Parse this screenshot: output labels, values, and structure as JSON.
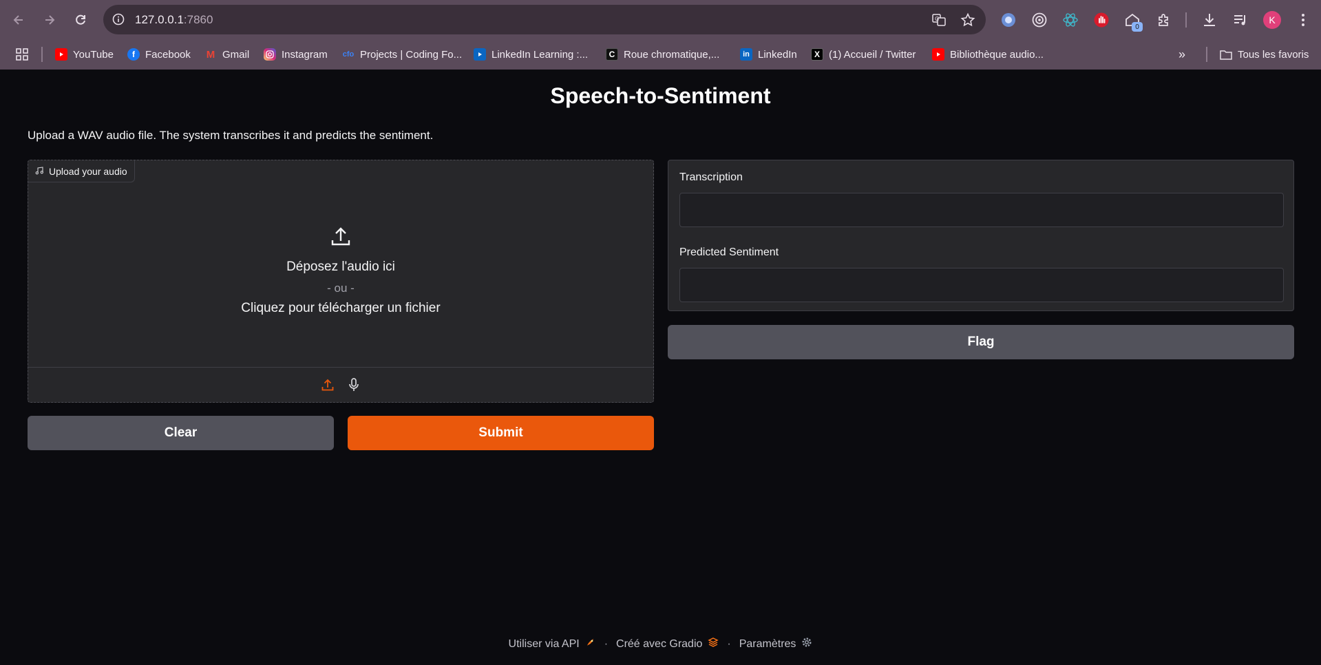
{
  "browser": {
    "url_host": "127.0.0.1",
    "url_port": ":7860",
    "avatar_letter": "K",
    "extension_badge": "0"
  },
  "bookmarks": [
    {
      "label": "YouTube",
      "icon": "youtube-icon",
      "color": "#ff0000"
    },
    {
      "label": "Facebook",
      "icon": "facebook-icon",
      "color": "#1877f2"
    },
    {
      "label": "Gmail",
      "icon": "gmail-icon",
      "color": "#ea4335"
    },
    {
      "label": "Instagram",
      "icon": "instagram-icon",
      "color": "#d62976"
    },
    {
      "label": "Projects | Coding Fo...",
      "icon": "codingfont-icon",
      "color": "#3b82f6"
    },
    {
      "label": "LinkedIn Learning :...",
      "icon": "linkedin-learning-icon",
      "color": "#0a66c2"
    },
    {
      "label": "Roue chromatique,...",
      "icon": "adobe-color-icon",
      "color": "#111111"
    },
    {
      "label": "LinkedIn",
      "icon": "linkedin-icon",
      "color": "#0a66c2"
    },
    {
      "label": "(1) Accueil / Twitter",
      "icon": "x-icon",
      "color": "#000000"
    },
    {
      "label": "Bibliothèque audio...",
      "icon": "youtube-icon",
      "color": "#ff0000"
    }
  ],
  "bookmarks_folder": "Tous les favoris",
  "app": {
    "title": "Speech-to-Sentiment",
    "description": "Upload a WAV audio file. The system transcribes it and predicts the sentiment.",
    "upload": {
      "label": "Upload your audio",
      "drop_text": "Déposez l'audio ici",
      "or_text": "- ou -",
      "click_text": "Cliquez pour télécharger un fichier"
    },
    "clear_label": "Clear",
    "submit_label": "Submit",
    "outputs": {
      "transcription_label": "Transcription",
      "transcription_value": "",
      "sentiment_label": "Predicted Sentiment",
      "sentiment_value": ""
    },
    "flag_label": "Flag"
  },
  "footer": {
    "api": "Utiliser via API",
    "gradio": "Créé avec Gradio",
    "settings": "Paramètres"
  },
  "colors": {
    "accent": "#ea580c",
    "secondary_button": "#52525b",
    "panel": "#27272a",
    "background": "#0b0b0f"
  }
}
